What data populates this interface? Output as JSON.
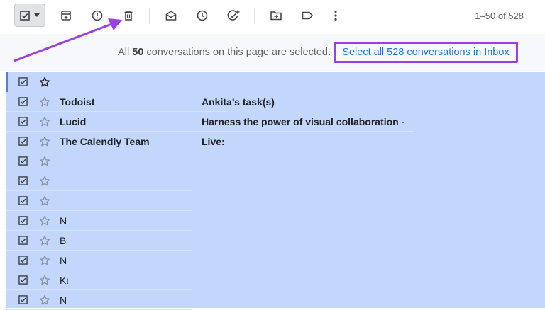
{
  "toolbar": {
    "select_icon": "checkbox-checked-icon",
    "dropdown_icon": "caret-down-icon",
    "actions": [
      "archive-icon",
      "report-spam-icon",
      "delete-icon",
      "mark-read-icon",
      "snooze-icon",
      "add-task-icon",
      "move-to-icon",
      "label-icon",
      "more-icon"
    ],
    "page_count": "1–50 of 528"
  },
  "banner": {
    "prefix": "All ",
    "count": "50",
    "suffix": " conversations on this page are selected.",
    "select_all_link": "Select all 528 conversations in Inbox"
  },
  "rows": [
    {
      "sender": "",
      "subject": ""
    },
    {
      "sender": "Todoist",
      "subject": "Ankita’s task(s)",
      "sep": ""
    },
    {
      "sender": "Lucid",
      "subject": "Harness the power of visual collaboration",
      "sep": " -"
    },
    {
      "sender": "The Calendly Team",
      "subject": "Live:",
      "sep": ""
    },
    {
      "sender": "",
      "subject": ""
    },
    {
      "sender": "",
      "subject": ""
    },
    {
      "sender": "",
      "subject": ""
    },
    {
      "sender": "N",
      "subject": ""
    },
    {
      "sender": "B",
      "subject": ""
    },
    {
      "sender": "N",
      "subject": ""
    },
    {
      "sender": "Kι",
      "subject": ""
    },
    {
      "sender": "N",
      "subject": ""
    }
  ],
  "colors": {
    "accent_purple": "#9b3fe0",
    "selected_row_bg": "#c2d7fb",
    "link_blue": "#1a73e8"
  }
}
